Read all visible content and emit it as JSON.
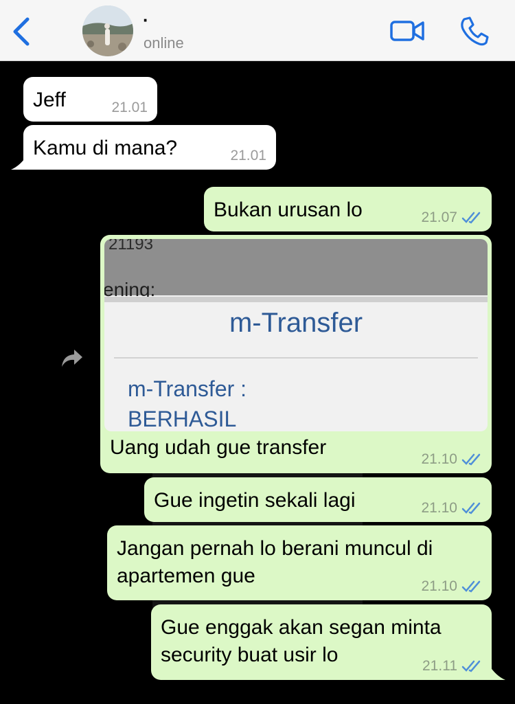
{
  "header": {
    "contact_name": "·",
    "status": "online",
    "icons": {
      "back": "chevron-left-icon",
      "video": "video-camera-icon",
      "call": "phone-icon"
    }
  },
  "messages": [
    {
      "direction": "incoming",
      "text": "Jeff",
      "time": "21.01"
    },
    {
      "direction": "incoming",
      "text": "Kamu di mana?",
      "time": "21.01"
    },
    {
      "direction": "outgoing",
      "text": "Bukan urusan lo",
      "time": "21.07",
      "status": "read"
    },
    {
      "direction": "outgoing",
      "type": "image",
      "image_text": {
        "top": "21193",
        "label": "ening:",
        "title": "m-Transfer",
        "line1": "m-Transfer :",
        "line2": "BERHASIL"
      },
      "text": "Uang udah gue transfer",
      "time": "21.10",
      "status": "read"
    },
    {
      "direction": "outgoing",
      "text": "Gue ingetin sekali lagi",
      "time": "21.10",
      "status": "read"
    },
    {
      "direction": "outgoing",
      "text_lines": [
        "Jangan pernah lo berani muncul di",
        "apartemen gue"
      ],
      "time": "21.10",
      "status": "read"
    },
    {
      "direction": "outgoing",
      "text_lines": [
        "Gue enggak akan segan minta",
        "security buat usir lo"
      ],
      "time": "21.11",
      "status": "read"
    }
  ],
  "colors": {
    "accent": "#1f6fe0",
    "outgoing_bubble": "#dcf8c6",
    "incoming_bubble": "#ffffff",
    "read_ticks": "#4f8fd8",
    "transfer_title": "#2e5a96"
  }
}
